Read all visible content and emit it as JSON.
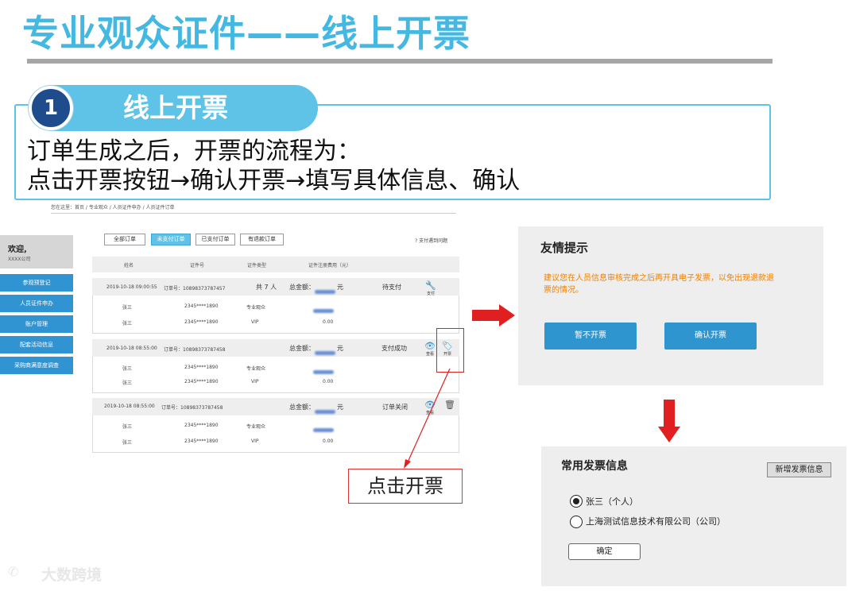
{
  "slide": {
    "title": "专业观众证件——线上开票",
    "step_number": "1",
    "step_title": "线上开票",
    "desc_line1": "订单生成之后，开票的流程为：",
    "desc_line2": "点击开票按钮→确认开票→填写具体信息、确认"
  },
  "breadcrumb": "您在这里：首页 / 专业观众 / 人员证件申办 / 人员证件订单",
  "sidebar": {
    "welcome": "欢迎,",
    "company": "XXXX公司",
    "items": [
      "参观预登记",
      "人员证件申办",
      "账户管理",
      "配套活动信息",
      "采购商满意度调查"
    ]
  },
  "tabs": [
    "全部订单",
    "未支付订单",
    "已支付订单",
    "有退款订单"
  ],
  "help_link": "? 支付遇到问题",
  "table_headers": [
    "姓名",
    "证件号",
    "证件类型",
    "证件注册费用（元）"
  ],
  "orders": [
    {
      "time": "2019-10-18 09:00:55",
      "order_no": "订单号：10898373787457",
      "count": "共 7 人",
      "total_label": "总金额：",
      "unit": "元",
      "status": "待支付",
      "actions": [
        {
          "icon": "wrench-icon",
          "label": "支付"
        }
      ],
      "rows": [
        {
          "name": "张三",
          "id": "2345****1890",
          "type": "专业观众",
          "fee": ""
        },
        {
          "name": "张三",
          "id": "2345****1890",
          "type": "VIP",
          "fee": "0.00"
        }
      ]
    },
    {
      "time": "2019-10-18 08:55:00",
      "order_no": "订单号：10898373787458",
      "count": "",
      "total_label": "总金额：",
      "unit": "元",
      "status": "支付成功",
      "actions": [
        {
          "icon": "eye-icon",
          "label": "查看"
        },
        {
          "icon": "ticket-icon",
          "label": "开票"
        }
      ],
      "rows": [
        {
          "name": "张三",
          "id": "2345****1890",
          "type": "专业观众",
          "fee": ""
        },
        {
          "name": "张三",
          "id": "2345****1890",
          "type": "VIP",
          "fee": "0.00"
        }
      ]
    },
    {
      "time": "2019-10-18 08:55:00",
      "order_no": "订单号：10898373787458",
      "count": "",
      "total_label": "总金额：",
      "unit": "元",
      "status": "订单关闭",
      "actions": [
        {
          "icon": "eye-icon",
          "label": "查看"
        },
        {
          "icon": "trash-icon",
          "label": ""
        }
      ],
      "rows": [
        {
          "name": "张三",
          "id": "2345****1890",
          "type": "专业观众",
          "fee": ""
        },
        {
          "name": "张三",
          "id": "2345****1890",
          "type": "VIP",
          "fee": "0.00"
        }
      ]
    }
  ],
  "callout": "点击开票",
  "dialog1": {
    "title": "友情提示",
    "message": "建议您在人员信息审核完成之后再开具电子发票，以免出现退款退票的情况。",
    "btn_cancel": "暂不开票",
    "btn_confirm": "确认开票"
  },
  "dialog2": {
    "title": "常用发票信息",
    "btn_add": "新增发票信息",
    "options": [
      "张三（个人）",
      "上海测试信息技术有限公司（公司）"
    ],
    "selected_index": 0,
    "btn_ok": "确定"
  },
  "watermark": "大数跨境",
  "colors": {
    "title_blue": "#45b8e2",
    "nav_blue": "#3094d3",
    "warn_orange": "#f08000",
    "arrow_red": "#e02020",
    "dark_navy": "#1e4c8c"
  }
}
